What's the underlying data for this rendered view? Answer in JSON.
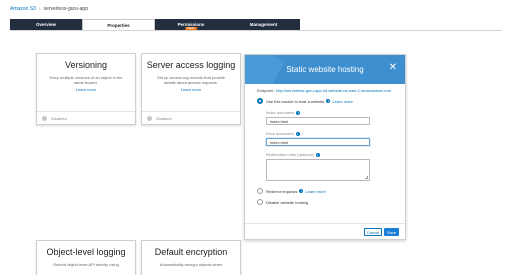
{
  "breadcrumb": {
    "root": "Amazon S3",
    "separator": "›",
    "current": "serverless-guru-app"
  },
  "tabs": [
    {
      "label": "Overview"
    },
    {
      "label": "Properties"
    },
    {
      "label": "Permissions",
      "badge": "Public"
    },
    {
      "label": "Management"
    }
  ],
  "cards": {
    "versioning": {
      "title": "Versioning",
      "description": "Keep multiple versions of an object in the same bucket.",
      "link": "Learn more",
      "status": "Disabled"
    },
    "access_logging": {
      "title": "Server access logging",
      "description": "Set up access log records that provide details about access requests.",
      "link": "Learn more",
      "status": "Disabled"
    },
    "object_logging": {
      "title": "Object-level logging",
      "description": "Record object-level API activity using"
    },
    "encryption": {
      "title": "Default encryption",
      "description": "Automatically encrypt objects when"
    }
  },
  "modal": {
    "title": "Static website hosting",
    "close": "✕",
    "endpoint_label": "Endpoint :",
    "endpoint_url": "http://serverless-guru-app.s3-website-us-east-1.amazonaws.com",
    "option_host": "Use this bucket to host a website",
    "learn_more": "Learn more",
    "index_label": "Index document",
    "index_value": "index.html",
    "error_label": "Error document",
    "error_value": "index.html",
    "redirect_rules_label": "Redirection rules (optional)",
    "option_redirect": "Redirect requests",
    "option_disable": "Disable website hosting",
    "cancel": "Cancel",
    "save": "Save"
  },
  "colors": {
    "nav_bg": "#232f3e",
    "header_blue": "#3d8fd0",
    "link": "#0073bb",
    "save": "#1a7dd6"
  }
}
